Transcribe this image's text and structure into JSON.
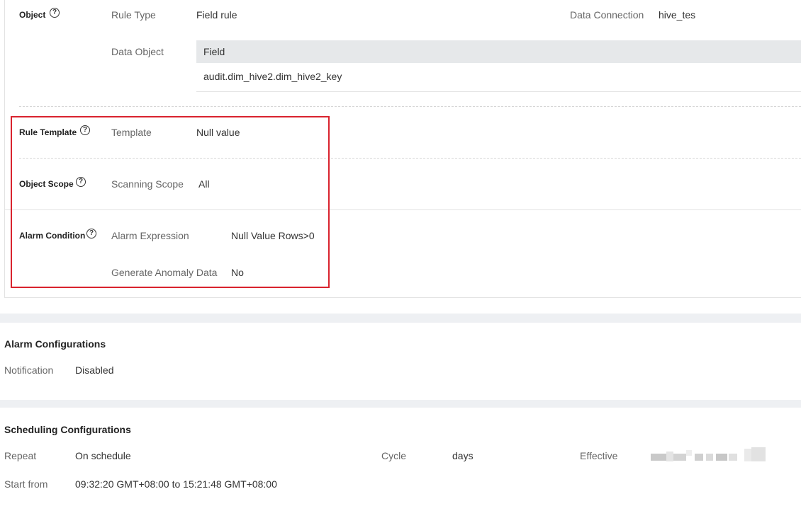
{
  "rule": {
    "object": {
      "label": "Object",
      "rule_type_key": "Rule Type",
      "rule_type_value": "Field rule",
      "data_connection_key": "Data Connection",
      "data_connection_value": "hive_tes",
      "data_object_key": "Data Object",
      "table_header": "Field",
      "table_row": "audit.dim_hive2.dim_hive2_key"
    },
    "template": {
      "label": "Rule Template",
      "key": "Template",
      "value": "Null value"
    },
    "scope": {
      "label": "Object Scope",
      "key": "Scanning Scope",
      "value": "All"
    },
    "alarm": {
      "label": "Alarm Condition",
      "expression_key": "Alarm Expression",
      "expression_value": "Null Value Rows>0",
      "anomaly_key": "Generate Anomaly Data",
      "anomaly_value": "No"
    },
    "help_icon": "?"
  },
  "alarm_config": {
    "title": "Alarm Configurations",
    "notification_key": "Notification",
    "notification_value": "Disabled"
  },
  "scheduling": {
    "title": "Scheduling Configurations",
    "repeat_key": "Repeat",
    "repeat_value": "On schedule",
    "cycle_key": "Cycle",
    "cycle_value": "days",
    "effective_key": "Effective",
    "start_key": "Start from",
    "start_value": "09:32:20 GMT+08:00 to 15:21:48 GMT+08:00"
  },
  "colors": {
    "highlight_border": "#d9232e",
    "table_header_bg": "#e6e8ea"
  }
}
